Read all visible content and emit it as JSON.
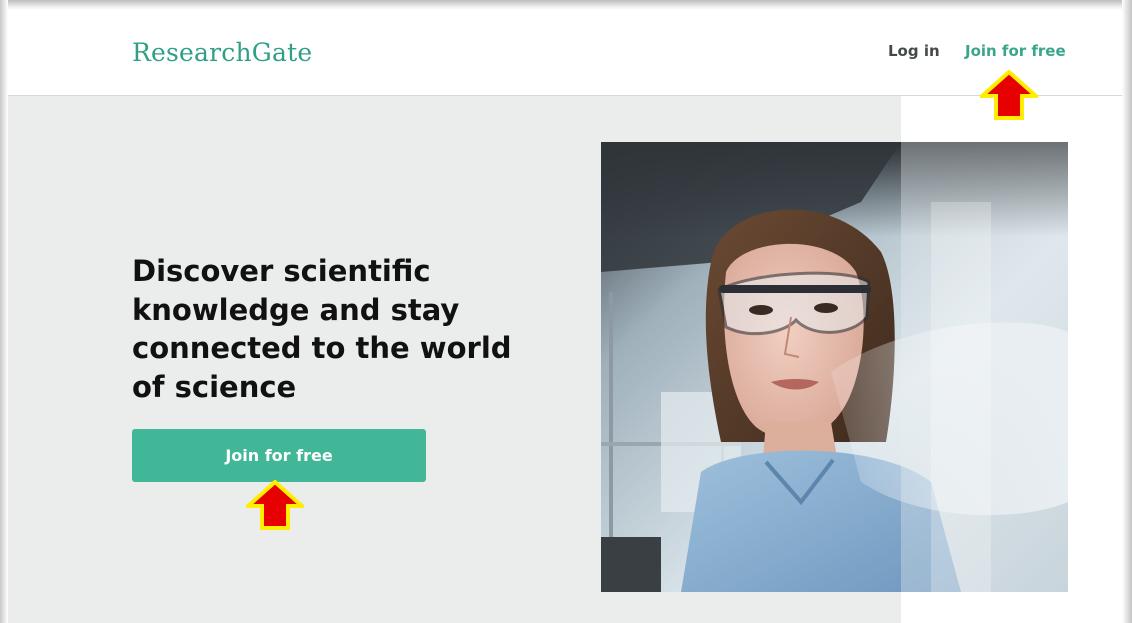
{
  "header": {
    "logo_text": "ResearchGate",
    "login_label": "Log in",
    "join_label": "Join for free"
  },
  "hero": {
    "headline": "Discover scientific knowledge and stay connected to the world of science",
    "cta_label": "Join for free"
  },
  "colors": {
    "brand_green": "#41b798",
    "logo_green": "#2f9f86",
    "hero_background": "#eaedec",
    "annotation_arrow_fill": "#e60000",
    "annotation_arrow_outline": "#ffee00"
  },
  "icons": {
    "annotation": "up-arrow-icon"
  }
}
